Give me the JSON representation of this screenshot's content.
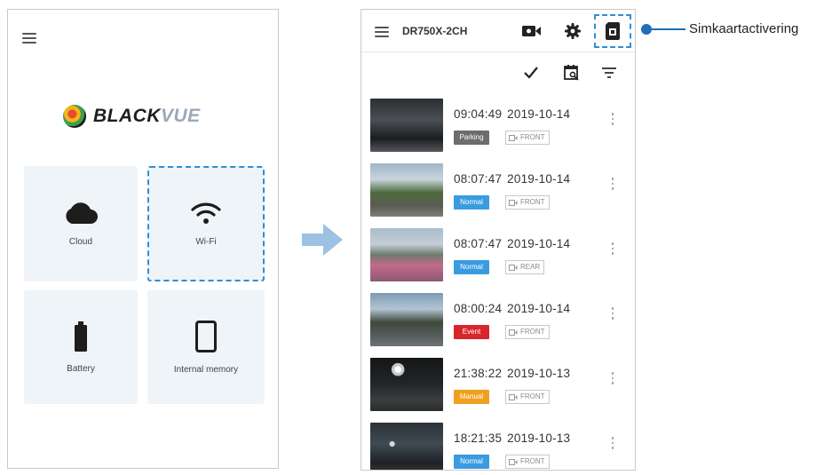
{
  "left_screen": {
    "brand": {
      "part1": "BLACK",
      "part2": "VUE"
    },
    "tiles": [
      {
        "label": "Cloud",
        "icon": "cloud-icon"
      },
      {
        "label": "Wi-Fi",
        "icon": "wifi-icon"
      },
      {
        "label": "Battery",
        "icon": "battery-icon"
      },
      {
        "label": "Internal memory",
        "icon": "phone-icon"
      }
    ]
  },
  "right_screen": {
    "device_name": "DR750X-2CH",
    "toolbar_icons": [
      "record-icon",
      "gear-icon",
      "sim-card-icon"
    ],
    "subtoolbar_icons": [
      "check-icon",
      "calendar-search-icon",
      "filter-icon"
    ],
    "recordings": [
      {
        "time": "09:04:49",
        "date": "2019-10-14",
        "type": "Parking",
        "camera": "FRONT"
      },
      {
        "time": "08:07:47",
        "date": "2019-10-14",
        "type": "Normal",
        "camera": "FRONT"
      },
      {
        "time": "08:07:47",
        "date": "2019-10-14",
        "type": "Normal",
        "camera": "REAR"
      },
      {
        "time": "08:00:24",
        "date": "2019-10-14",
        "type": "Event",
        "camera": "FRONT"
      },
      {
        "time": "21:38:22",
        "date": "2019-10-13",
        "type": "Manual",
        "camera": "FRONT"
      },
      {
        "time": "18:21:35",
        "date": "2019-10-13",
        "type": "Normal",
        "camera": "FRONT"
      }
    ]
  },
  "callout": {
    "label": "Simkaartactivering"
  },
  "colors": {
    "accent_blue": "#2a8fd6",
    "callout_blue": "#1f6fb5",
    "tile_bg": "#eef4f8",
    "arrow": "#9cc1e2",
    "badge_parking": "#6d6d6d",
    "badge_normal": "#3a9be0",
    "badge_event": "#d8262a",
    "badge_manual": "#f0a020"
  }
}
